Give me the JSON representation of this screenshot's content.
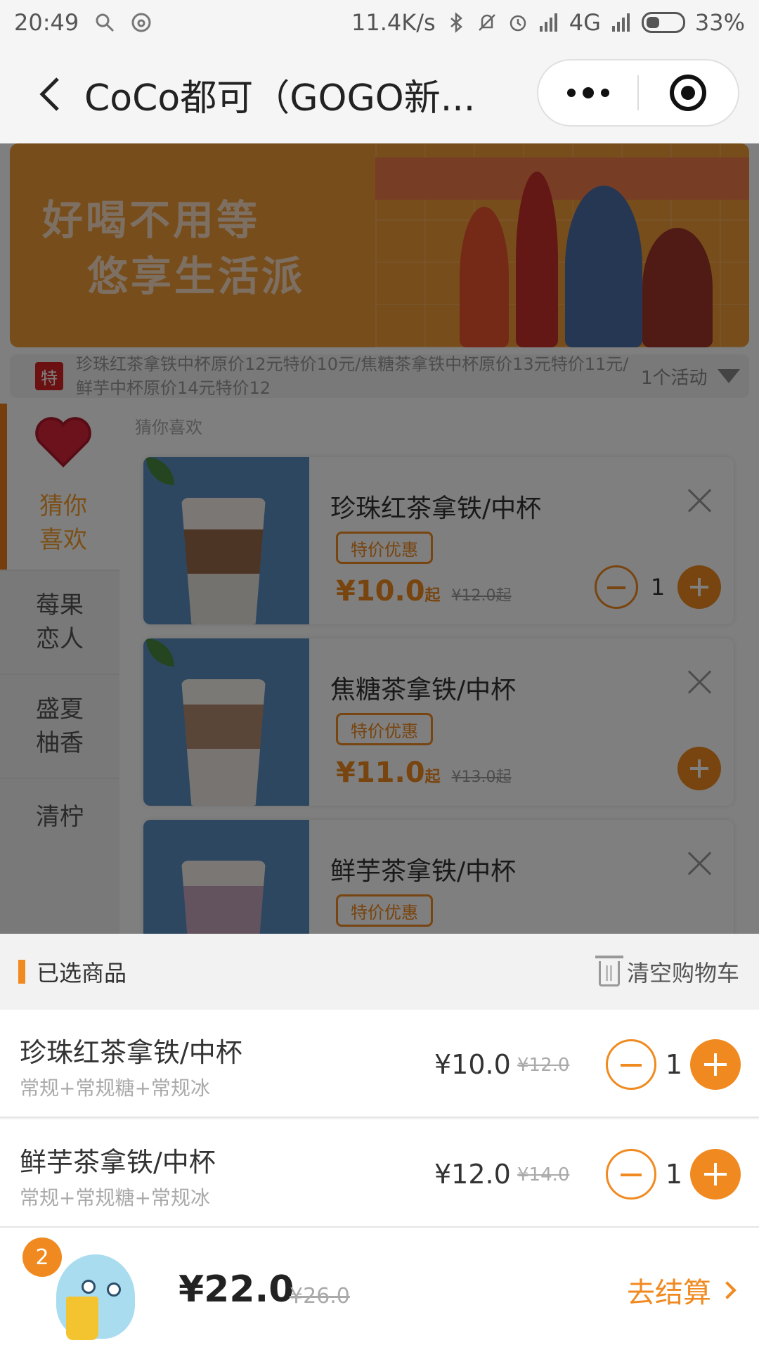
{
  "status_bar": {
    "time": "20:49",
    "net_speed": "11.4K/s",
    "network": "4G",
    "battery": "33%"
  },
  "nav": {
    "title": "CoCo都可（GOGO新..."
  },
  "banner": {
    "line1": "好喝不用等",
    "line2": "悠享生活派"
  },
  "promo": {
    "badge": "特",
    "text": "珍珠红茶拿铁中杯原价12元特价10元/焦糖茶拿铁中杯原价13元特价11元/鲜芋中杯原价14元特价12",
    "count": "1个活动"
  },
  "sidebar": {
    "items": [
      {
        "label": "猜你喜欢"
      },
      {
        "label": "莓果恋人"
      },
      {
        "label": "盛夏柚香"
      },
      {
        "label": "清柠"
      }
    ]
  },
  "section_label": "猜你喜欢",
  "products": [
    {
      "name": "珍珠红茶拿铁/中杯",
      "tag": "特价优惠",
      "price": "¥10.0",
      "qi": "起",
      "old_price": "¥12.0起",
      "qty": "1"
    },
    {
      "name": "焦糖茶拿铁/中杯",
      "tag": "特价优惠",
      "price": "¥11.0",
      "qi": "起",
      "old_price": "¥13.0起"
    },
    {
      "name": "鲜芋茶拿铁/中杯",
      "tag": "特价优惠"
    }
  ],
  "cart": {
    "title": "已选商品",
    "clear_label": "清空购物车",
    "items": [
      {
        "name": "珍珠红茶拿铁/中杯",
        "spec": "常规+常规糖+常规冰",
        "price": "¥10.0",
        "old_price": "¥12.0",
        "qty": "1"
      },
      {
        "name": "鲜芋茶拿铁/中杯",
        "spec": "常规+常规糖+常规冰",
        "price": "¥12.0",
        "old_price": "¥14.0",
        "qty": "1"
      }
    ]
  },
  "bottom": {
    "badge_count": "2",
    "total": "¥22.0",
    "total_old": "¥26.0",
    "checkout_label": "去结算"
  },
  "colors": {
    "accent": "#f08a20",
    "badge_red": "#d62323",
    "banner": "#f19a38"
  }
}
